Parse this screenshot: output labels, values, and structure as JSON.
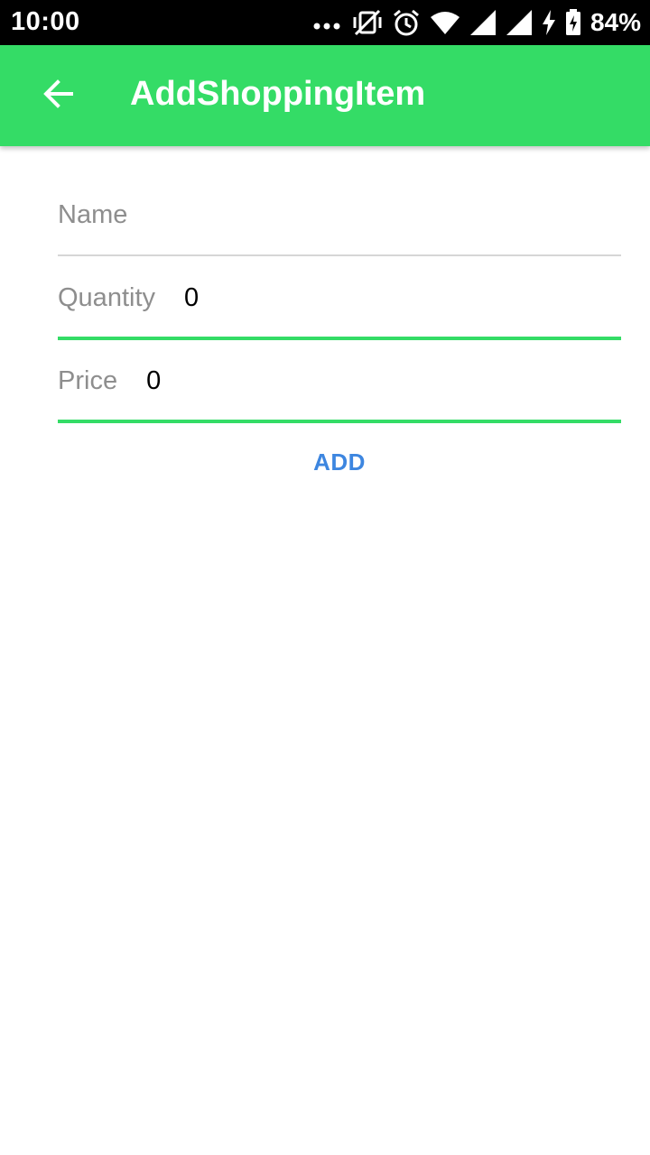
{
  "status_bar": {
    "time": "10:00",
    "battery": "84%",
    "icons": [
      "more-dots-icon",
      "vibrate-off-icon",
      "alarm-icon",
      "wifi-icon",
      "signal-icon",
      "signal-icon",
      "charging-icon",
      "battery-icon"
    ]
  },
  "app_bar": {
    "title": "AddShoppingItem",
    "back_icon": "arrow-back-icon",
    "color": "#34dc66"
  },
  "form": {
    "name": {
      "placeholder": "Name",
      "value": ""
    },
    "quantity": {
      "label": "Quantity",
      "value": "0"
    },
    "price": {
      "label": "Price",
      "value": "0"
    }
  },
  "actions": {
    "add_label": "ADD",
    "add_color": "#3d86e0"
  }
}
